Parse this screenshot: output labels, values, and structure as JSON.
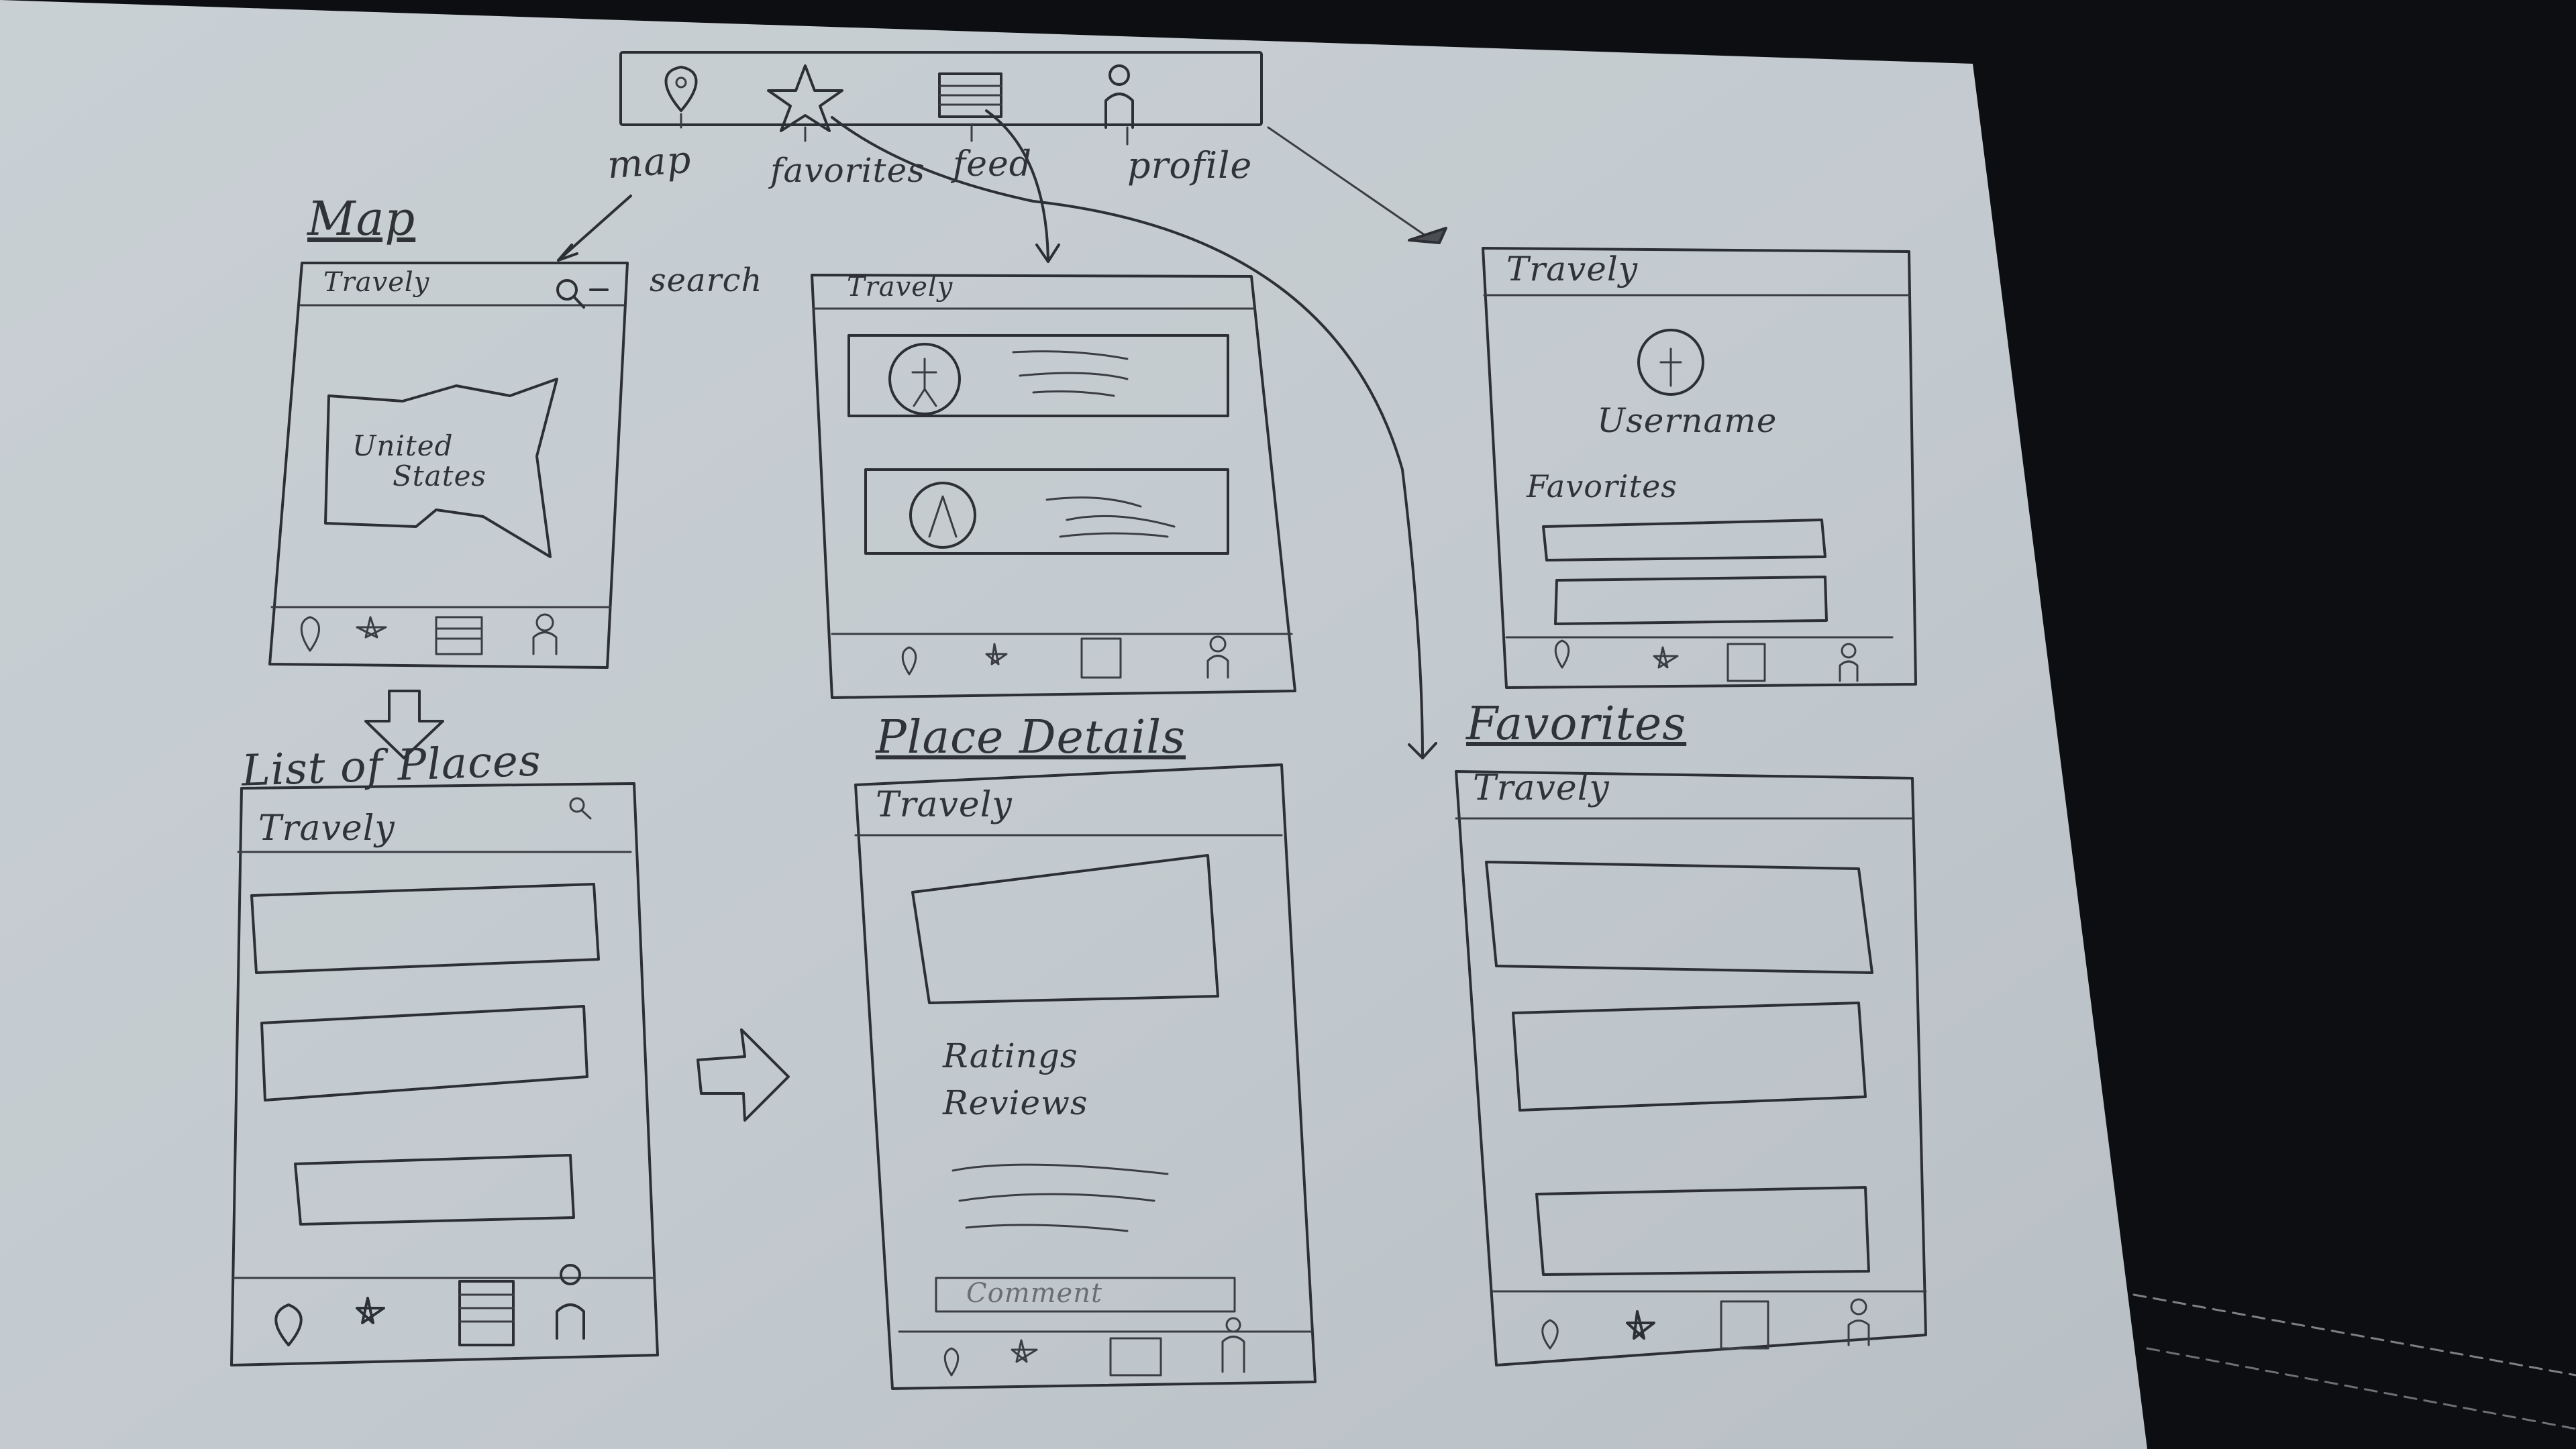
{
  "nav_bar": {
    "labels": [
      "map",
      "favorites",
      "feed",
      "profile"
    ],
    "icons": [
      "map-pin-icon",
      "star-icon",
      "feed-icon",
      "person-icon"
    ]
  },
  "annotations": {
    "search": "search"
  },
  "screens": {
    "map": {
      "heading": "Map",
      "app_title": "Travely",
      "map_label_line1": "United",
      "map_label_line2": "States"
    },
    "feed": {
      "app_title": "Travely"
    },
    "profile": {
      "app_title": "Travely",
      "username": "Username",
      "section": "Favorites"
    },
    "list_of_places": {
      "heading": "List of Places",
      "app_title": "Travely"
    },
    "place_details": {
      "heading": "Place Details",
      "app_title": "Travely",
      "ratings": "Ratings",
      "reviews": "Reviews",
      "comment": "Comment"
    },
    "favorites": {
      "heading": "Favorites",
      "app_title": "Travely"
    }
  },
  "colors": {
    "paper": "#c4cbd0",
    "ink": "#2c2f33",
    "background": "#0d0e12"
  }
}
